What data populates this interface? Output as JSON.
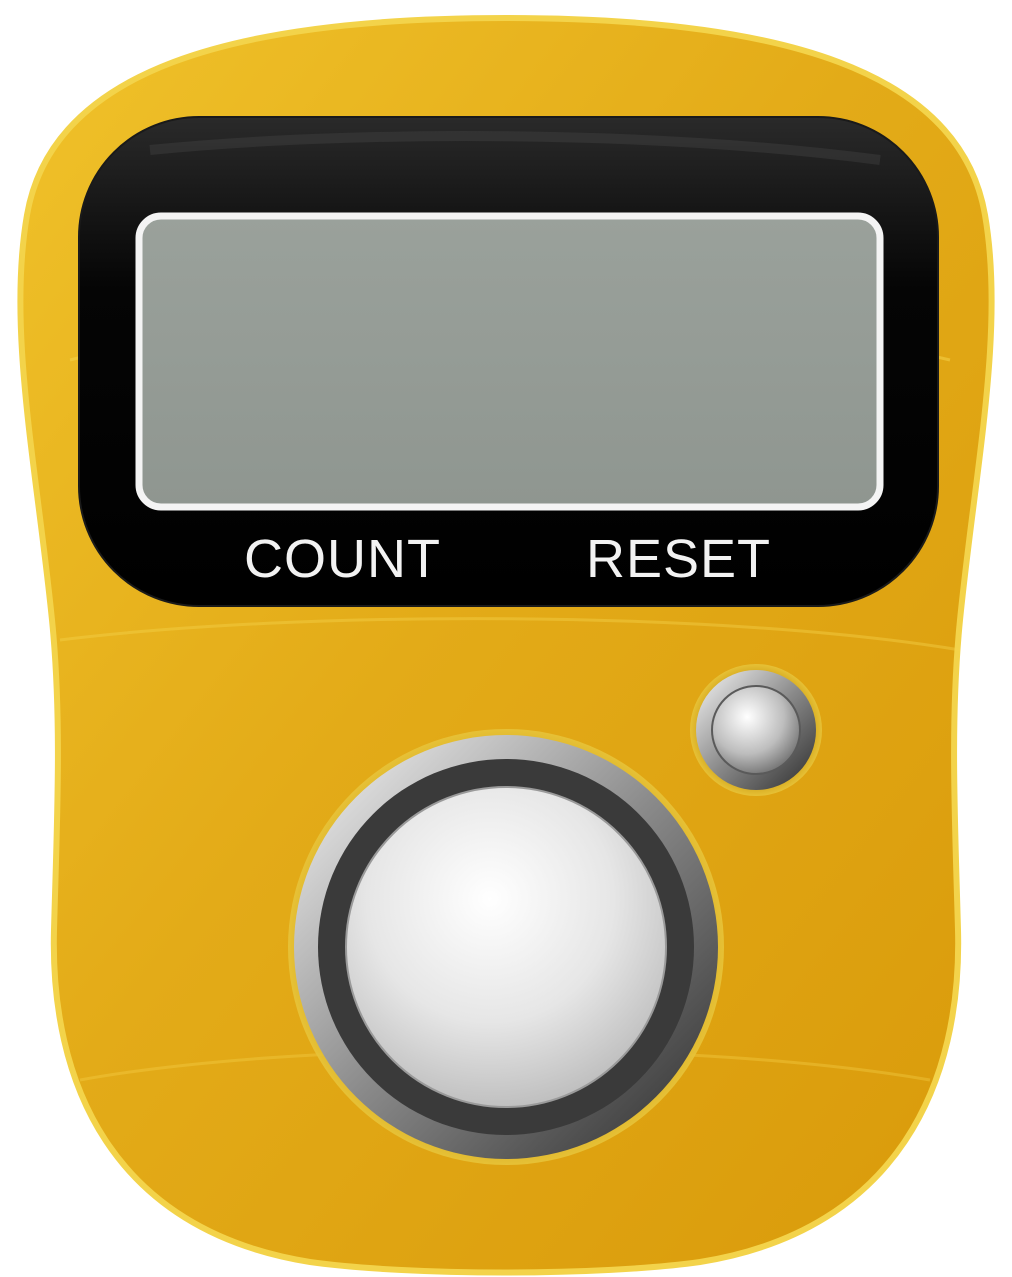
{
  "device": {
    "name": "tally-counter",
    "body_color": "#e0a814",
    "body_highlight": "#f2cf3a",
    "bezel_color": "#0b0b0b",
    "screen_color": "#959c96"
  },
  "labels": {
    "count": "COUNT",
    "reset": "RESET"
  },
  "buttons": {
    "count_button": "count-button",
    "reset_button": "reset-button"
  }
}
